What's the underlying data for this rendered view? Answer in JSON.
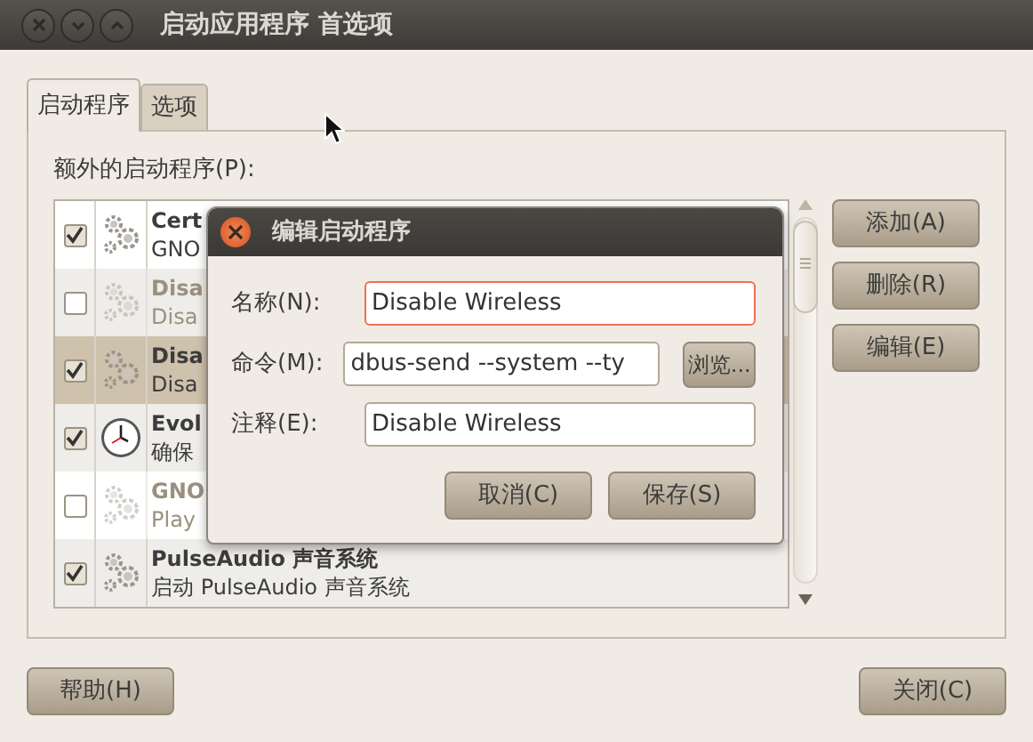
{
  "window": {
    "title": "启动应用程序 首选项"
  },
  "tabs": [
    {
      "label": "启动程序",
      "selected": true
    },
    {
      "label": "选项",
      "selected": false
    }
  ],
  "list_label": "额外的启动程序(P):",
  "programs": [
    {
      "name": "Cert",
      "description": "GNO",
      "checked": true,
      "selected": false,
      "kind": "gears"
    },
    {
      "name": "Disa",
      "description": "Disa",
      "checked": false,
      "selected": false,
      "kind": "gears"
    },
    {
      "name": "Disa",
      "description": "Disa",
      "checked": true,
      "selected": true,
      "kind": "gears"
    },
    {
      "name": "Evol",
      "description": "确保",
      "checked": true,
      "selected": false,
      "kind": "clock"
    },
    {
      "name": "GNO",
      "description": "Play",
      "checked": false,
      "selected": false,
      "kind": "gears"
    },
    {
      "name": "PulseAudio 声音系统",
      "description": "启动 PulseAudio 声音系统",
      "checked": true,
      "selected": false,
      "kind": "gears"
    }
  ],
  "side_buttons": [
    "添加(A)",
    "删除(R)",
    "编辑(E)"
  ],
  "bottom_buttons": {
    "help": "帮助(H)",
    "close": "关闭(C)"
  },
  "dialog": {
    "title": "编辑启动程序",
    "fields": [
      {
        "label": "名称(N):",
        "value": "Disable Wireless",
        "focused": true
      },
      {
        "label": "命令(M):",
        "value": "dbus-send --system --ty",
        "focused": false,
        "browse": "浏览..."
      },
      {
        "label": "注释(E):",
        "value": "Disable Wireless",
        "focused": false
      }
    ],
    "buttons": [
      "取消(C)",
      "保存(S)"
    ]
  }
}
